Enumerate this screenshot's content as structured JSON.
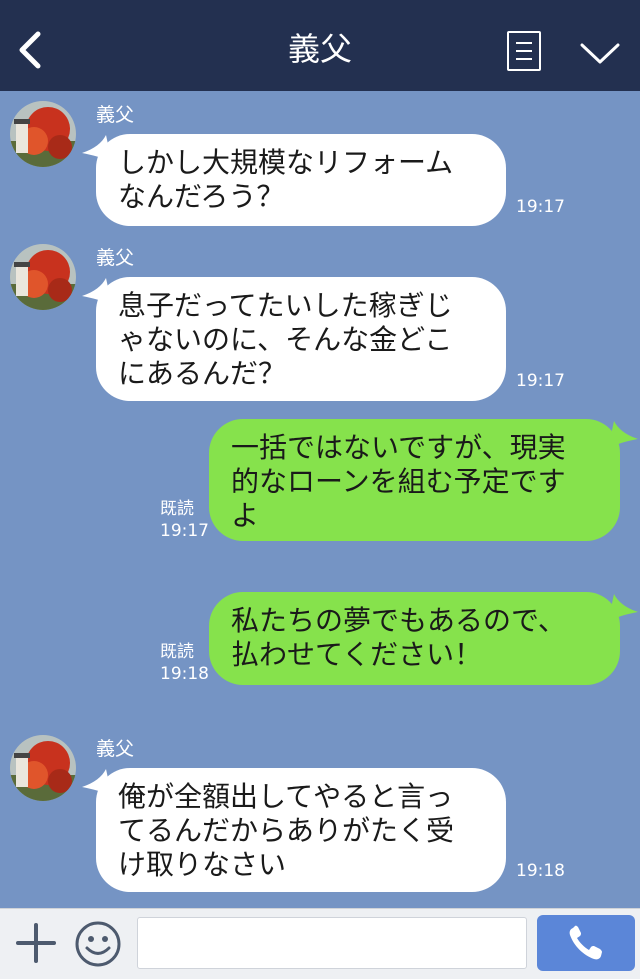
{
  "header": {
    "title": "義父"
  },
  "messages": [
    {
      "sender": "義父",
      "side": "left",
      "text": "しかし大規模なリフォーム\nなんだろう？",
      "time": "19:17"
    },
    {
      "sender": "義父",
      "side": "left",
      "text": "息子だってたいした稼ぎじ\nゃないのに、そんな金どこ\nにあるんだ？",
      "time": "19:17"
    },
    {
      "side": "right",
      "text": "一括ではないですが、現実\n的なローンを組む予定です\nよ",
      "read": "既読",
      "time": "19:17"
    },
    {
      "side": "right",
      "text": "私たちの夢でもあるので、\n払わせてください！",
      "read": "既読",
      "time": "19:18"
    },
    {
      "sender": "義父",
      "side": "left",
      "text": "俺が全額出してやると言っ\nてるんだからありがたく受\nけ取りなさい",
      "time": "19:18"
    }
  ],
  "footer": {
    "input_value": "",
    "icons": [
      "plus-icon",
      "emoji-icon",
      "phone-icon"
    ]
  },
  "colors": {
    "header": "#233050",
    "background": "#7594c4",
    "incoming": "#ffffff",
    "outgoing": "#86e24c",
    "call_button": "#5b86d8"
  }
}
